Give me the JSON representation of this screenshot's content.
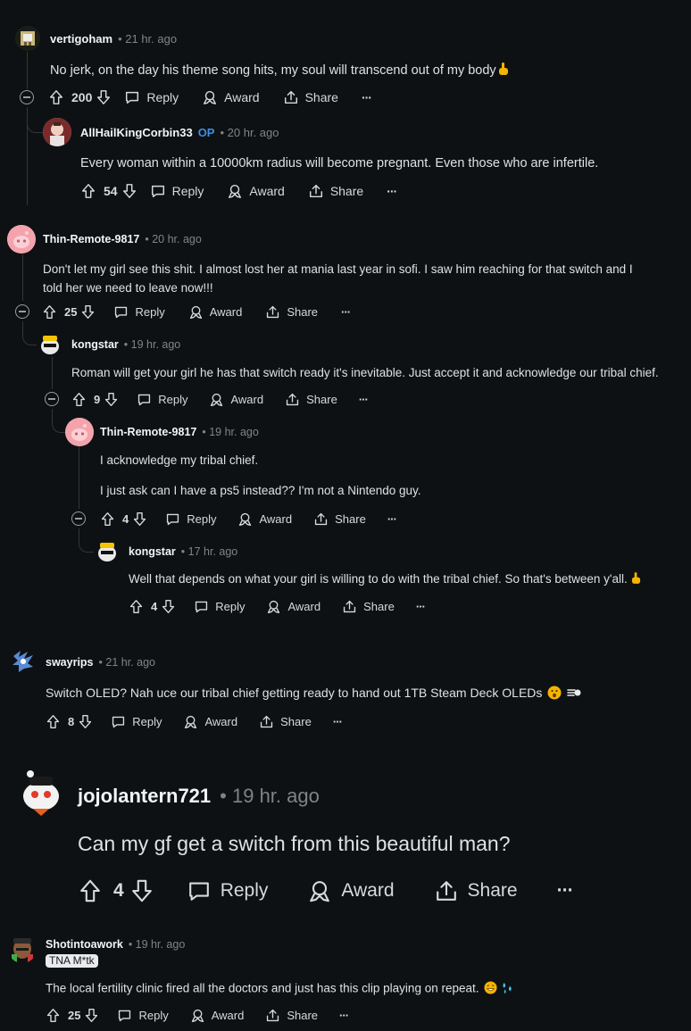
{
  "colors": {
    "background": "#0e1113",
    "text": "#d7dadc",
    "muted": "#818384",
    "op_badge": "#3b8ee8",
    "thread_line": "#343536"
  },
  "action_labels": {
    "reply": "Reply",
    "award": "Award",
    "share": "Share",
    "more": "···"
  },
  "comments": [
    {
      "author": "vertigoham",
      "time": "21 hr. ago",
      "text": "No jerk, on the day his theme song hits, my soul will transcend out of my body",
      "votes": "200"
    },
    {
      "author": "AllHailKingCorbin33",
      "op_badge": "OP",
      "time": "20 hr. ago",
      "text": "Every woman within a 10000km radius will become pregnant. Even those who are infertile.",
      "votes": "54"
    },
    {
      "author": "Thin-Remote-9817",
      "time": "20 hr. ago",
      "text_line1": "Don't let my girl see this shit. I almost lost her at mania last year in sofi. I saw him reaching for that switch and I",
      "text_line2": "told her we need to leave now!!!",
      "votes": "25"
    },
    {
      "author": "kongstar",
      "time": "19 hr. ago",
      "text": "Roman will get your girl he has that switch ready it's inevitable. Just accept it and acknowledge our tribal chief.",
      "votes": "9"
    },
    {
      "author": "Thin-Remote-9817",
      "time": "19 hr. ago",
      "text_line1": "I acknowledge my tribal chief.",
      "text_line2": "I just ask can I have a ps5 instead?? I'm not a Nintendo guy.",
      "votes": "4"
    },
    {
      "author": "kongstar",
      "time": "17 hr. ago",
      "text": "Well that depends on what your girl is willing to do with the tribal chief. So that's between y'all.",
      "votes": "4"
    },
    {
      "author": "swayrips",
      "time": "21 hr. ago",
      "text": "Switch OLED? Nah uce our tribal chief getting ready to hand out 1TB Steam Deck OLEDs",
      "votes": "8"
    },
    {
      "author": "jojolantern721",
      "time": "19 hr. ago",
      "text": "Can my gf get a switch from this beautiful man?",
      "votes": "4"
    },
    {
      "author": "Shotintoawork",
      "flair": "TNA M*tk",
      "time": "19 hr. ago",
      "text": "The local fertility clinic fired all the doctors and just has this clip playing on repeat.",
      "votes": "25"
    }
  ]
}
